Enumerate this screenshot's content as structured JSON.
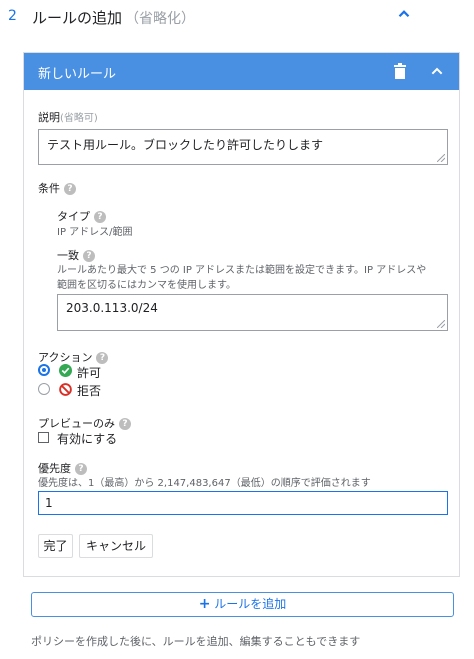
{
  "step": {
    "number": "2",
    "title": "ルールの追加",
    "optional": "（省略化）"
  },
  "card": {
    "title": "新しいルール",
    "description": {
      "label": "説明",
      "optional": "(省略可)",
      "value": "テスト用ルール。ブロックしたり許可したりします"
    },
    "conditions": {
      "label": "条件",
      "type_label": "タイプ",
      "type_value": "IP アドレス/範囲",
      "match_label": "一致",
      "match_help_line1": "ルールあたり最大で 5 つの IP アドレスまたは範囲を設定できます。IP アドレスや",
      "match_help_line2": "範囲を区切るにはカンマを使用します。",
      "match_value": "203.0.113.0/24"
    },
    "action": {
      "label": "アクション",
      "options": [
        {
          "label": "許可",
          "selected": true
        },
        {
          "label": "拒否",
          "selected": false
        }
      ]
    },
    "preview": {
      "label": "プレビューのみ",
      "checkbox_label": "有効にする",
      "checked": false
    },
    "priority": {
      "label": "優先度",
      "help": "優先度は、1（最高）から 2,147,483,647（最低）の順序で評価されます",
      "value": "1"
    },
    "buttons": {
      "done": "完了",
      "cancel": "キャンセル"
    }
  },
  "add_rule": {
    "label": "ルールを追加"
  },
  "footer": "ポリシーを作成した後に、ルールを追加、編集することもできます",
  "colors": {
    "accent": "#1a73e8",
    "header": "#4a90e2",
    "allow": "#34a853",
    "deny": "#d93025"
  },
  "icons": {
    "trash": "trash-icon",
    "chevron": "chevron-up-icon",
    "help": "help-icon",
    "allow": "check-circle-icon",
    "deny": "block-icon",
    "add": "plus-icon"
  }
}
